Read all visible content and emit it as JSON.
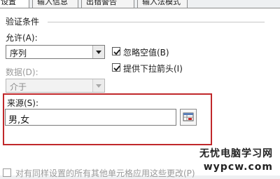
{
  "tabs": [
    {
      "label": "设置",
      "active": true
    },
    {
      "label": "输入信息",
      "active": false
    },
    {
      "label": "出错警告",
      "active": false
    },
    {
      "label": "输入法模式",
      "active": false
    }
  ],
  "criteria": {
    "group_title": "验证条件",
    "allow_label": "允许(A):",
    "allow_value": "序列",
    "ignore_blank_label": "忽略空值(B)",
    "ignore_blank_checked": true,
    "dropdown_label": "提供下拉箭头(I)",
    "dropdown_checked": true,
    "data_label": "数据(D):",
    "data_value": "介于",
    "source_label": "来源(S):",
    "source_value": "男,女"
  },
  "apply_all_label": "对有同样设置的所有其他单元格应用这些更改(P)",
  "watermark": {
    "line1": "无忧电脑学习网",
    "line2": "wypcw.com"
  },
  "colors": {
    "highlight": "#c0282b"
  }
}
